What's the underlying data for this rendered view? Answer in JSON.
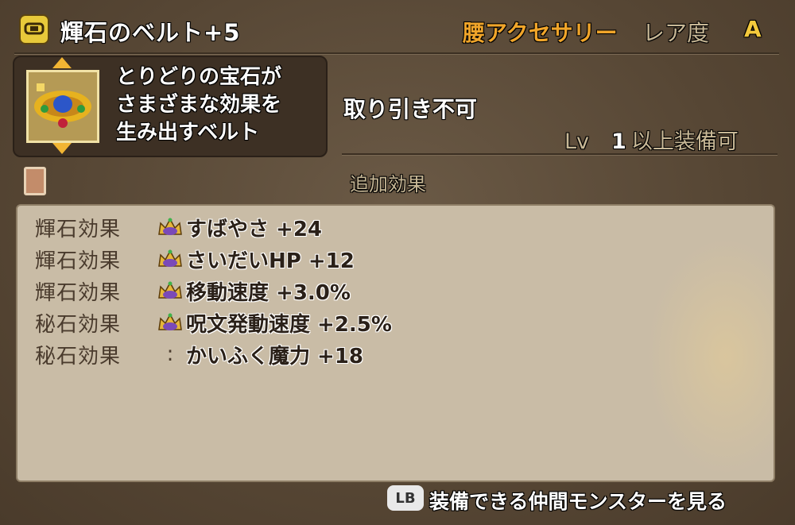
{
  "header": {
    "item_name": "輝石のベルト+5",
    "category": "腰アクセサリー",
    "rarity_label": "レア度",
    "rarity_value": "A"
  },
  "item": {
    "description_lines": [
      "とりどりの宝石が",
      "さまざまな効果を",
      "生み出すベルト"
    ],
    "trade_status": "取り引き不可",
    "equip_level_prefix": "Lv",
    "equip_level": "1",
    "equip_level_suffix": "以上装備可"
  },
  "effects_section": {
    "label": "追加効果",
    "rows": [
      {
        "type": "輝石効果",
        "mark": "crown-icon",
        "text": "すばやさ +24"
      },
      {
        "type": "輝石効果",
        "mark": "crown-icon",
        "text": "さいだいHP +12"
      },
      {
        "type": "輝石効果",
        "mark": "crown-icon",
        "text": "移動速度 +3.0%"
      },
      {
        "type": "秘石効果",
        "mark": "crown-icon",
        "text": "呪文発動速度 +2.5%"
      },
      {
        "type": "秘石効果",
        "mark": ":",
        "text": "かいふく魔力 +18"
      }
    ]
  },
  "footer": {
    "button": "LB",
    "label": "装備できる仲間モンスターを見る"
  },
  "colors": {
    "category": "#f0a52a",
    "rarity_value": "#f4c93c",
    "crown_gold": "#e5b63a",
    "crown_purple": "#7a4ab8"
  }
}
